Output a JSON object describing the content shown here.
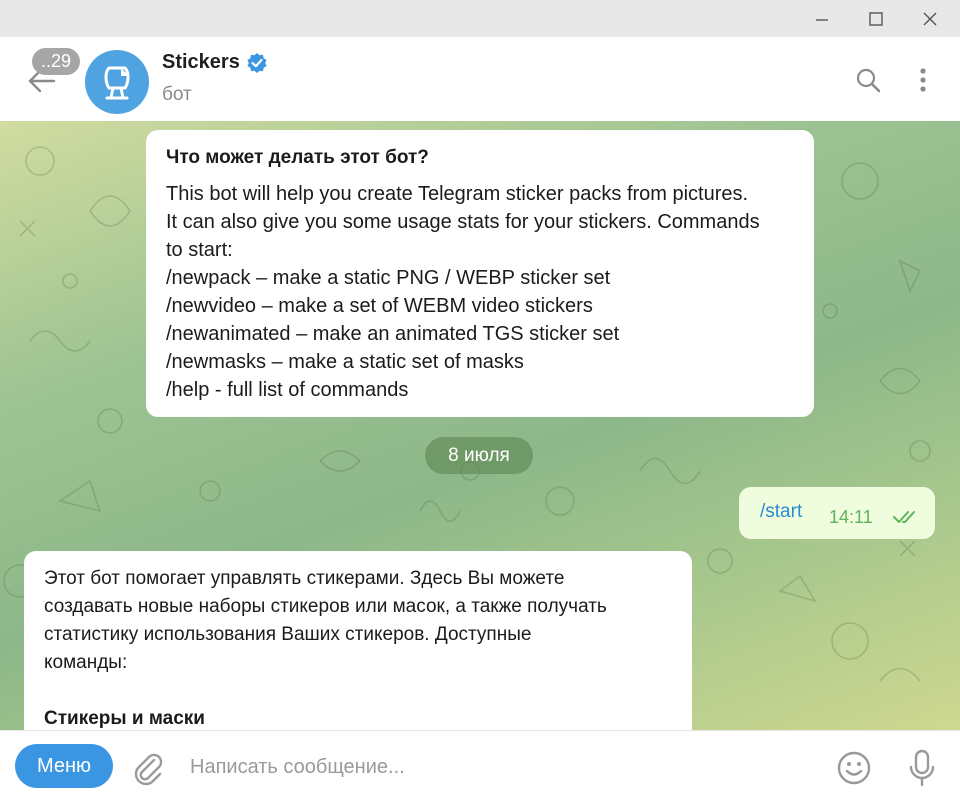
{
  "window": {
    "controls": [
      "minimize-icon",
      "maximize-icon",
      "close-icon"
    ]
  },
  "header": {
    "unread_count": "..29",
    "title": "Stickers",
    "status": "бот",
    "verified_icon": "verified-badge-icon",
    "avatar_icon": "sticker-bot-avatar-icon",
    "actions": [
      "search-icon",
      "more-vertical-icon"
    ]
  },
  "intro": {
    "title": "Что может делать этот бот?",
    "lines": [
      "This bot will help you create Telegram sticker packs from pictures.",
      "It can also give you some usage stats for your stickers. Commands",
      "to start:",
      "/newpack – make a static PNG / WEBP sticker set",
      "/newvideo – make a set of WEBM video stickers",
      "/newanimated – make an animated TGS sticker set",
      "/newmasks – make a static set of masks",
      "/help - full list of commands"
    ]
  },
  "date_separator": "8 июля",
  "outgoing": {
    "text": "/start",
    "time": "14:11",
    "status_icon": "double-check-icon"
  },
  "incoming": {
    "lines": [
      "Этот бот помогает управлять стикерами. Здесь Вы можете",
      "создавать новые наборы стикеров или масок, а также получать",
      "статистику использования Ваших стикеров. Доступные",
      "команды:"
    ],
    "heading": "Стикеры и маски"
  },
  "composer": {
    "menu_label": "Меню",
    "placeholder": "Написать сообщение...",
    "icons": [
      "paperclip-icon",
      "emoji-icon",
      "microphone-icon"
    ]
  },
  "colors": {
    "accent": "#3a95e3",
    "outgoing_bubble": "#effdde",
    "outgoing_time": "#5fb35a",
    "command_link": "#2b8bd0"
  }
}
